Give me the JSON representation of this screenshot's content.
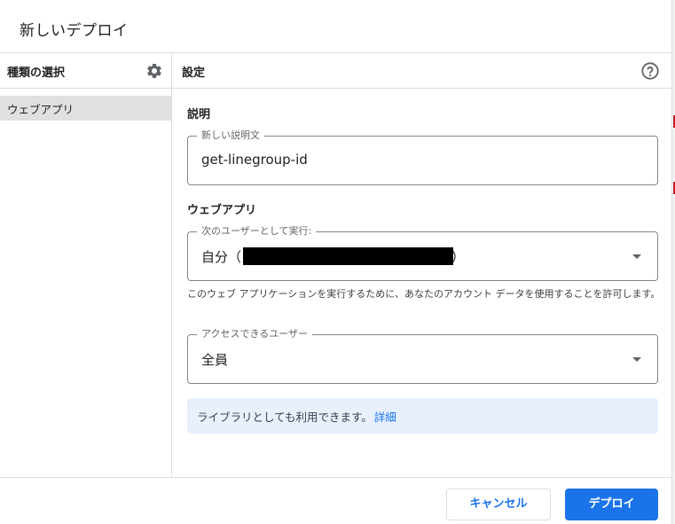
{
  "dialog": {
    "title": "新しいデプロイ"
  },
  "sidebar": {
    "title": "種類の選択",
    "settings_icon": "gear-icon",
    "items": [
      {
        "label": "ウェブアプリ",
        "selected": true
      }
    ]
  },
  "main": {
    "title": "設定",
    "help_icon": "help-circle-icon",
    "description_section": {
      "label": "説明",
      "field_legend": "新しい説明文",
      "field_value": "get-linegroup-id"
    },
    "webapp_section": {
      "label": "ウェブアプリ",
      "execute_as": {
        "legend": "次のユーザーとして実行:",
        "value": "自分（",
        "value_suffix": "）",
        "value_redacted": true
      },
      "helper_text": "このウェブ アプリケーションを実行するために、あなたのアカウント データを使用することを許可します。",
      "access": {
        "legend": "アクセスできるユーザー",
        "value": "全員"
      }
    },
    "info_box": {
      "text": "ライブラリとしても利用できます。",
      "link": "詳細"
    }
  },
  "footer": {
    "cancel_label": "キャンセル",
    "deploy_label": "デプロイ"
  },
  "colors": {
    "accent": "#1a73e8",
    "info_background": "#e8f0fe",
    "selected_item": "#e0e0e0",
    "border": "#dadce0"
  }
}
